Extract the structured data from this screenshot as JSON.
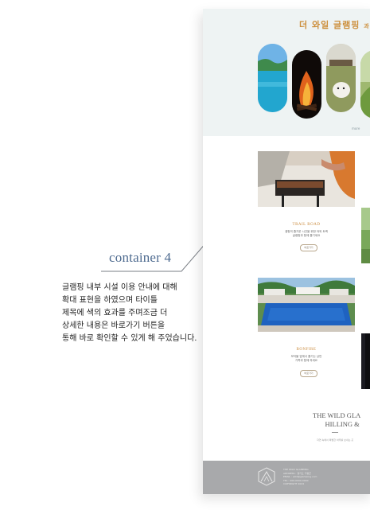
{
  "annotation": {
    "title": "container 4",
    "body": "글램핑 내부 시설 이용 안내에 대해\n확대 표현을 하였으며 타이틀\n제목에 색의 효과를 주며조금 더\n상세한 내용은 바로가기 버튼을\n통해 바로 확인할 수 있게 해 주었습니다."
  },
  "preview": {
    "hero_title": "더 와일 글램핑",
    "hero_title_suffix": "과",
    "hero_more": "more",
    "cards": [
      {
        "title": "TRAIL ROAD",
        "desc": "캠핑의 즐거운 시간을 위한 야외 트랙\n글램핑과 함께 즐기세요",
        "button": "바로가기"
      },
      {
        "title": "BONFIRE",
        "desc": "모닥불 앞에서 즐기는 낭만\n가족과 함께 하세요",
        "button": "바로가기"
      }
    ],
    "brand_line1": "THE WILD GLA",
    "brand_line2": "HILLING &",
    "brand_sub": "자연 속에서 특별한 하루를 보내는 곳",
    "footer_text": "THE WILD GLAMPING\nADDRESS : 경기도 가평군\nEMAIL : wild@glamping.com\nTEL : 000-0000-0000\nCOPYRIGHT 2024"
  },
  "colors": {
    "note_title": "#4d6a8f",
    "accent": "#cc8e3b",
    "hero_bg": "#eef3f3",
    "footer_bg": "#a8a9ab"
  }
}
